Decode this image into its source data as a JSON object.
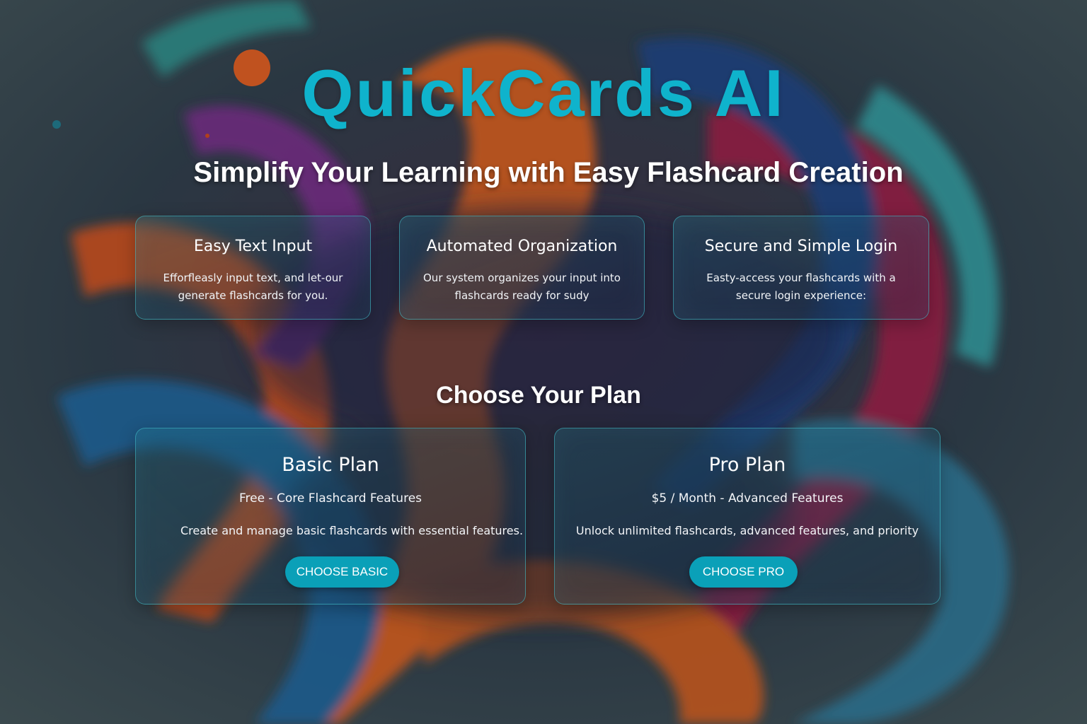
{
  "brand": "QuickCards AI",
  "tagline": "Simplify Your Learning with Easy Flashcard Creation",
  "features": [
    {
      "title": "Easy Text Input",
      "description": "Efforfleasly input text, and let-our generate flashcards for you."
    },
    {
      "title": "Automated Organization",
      "description": "Our system organizes your input into flashcards ready for sudy"
    },
    {
      "title": "Secure and Simple Login",
      "description": "Easty-access your flashcards with a secure login experience:"
    }
  ],
  "plans_heading": "Choose Your Plan",
  "plans": [
    {
      "name": "Basic Plan",
      "price": "Free - Core Flashcard Features",
      "description": "Create and manage basic flashcards with essential features.",
      "button": "CHOOSE BASIC"
    },
    {
      "name": "Pro Plan",
      "price": "$5 / Month - Advanced Features",
      "description": "Unlock unlimited flashcards, advanced features, and priority",
      "button": "CHOOSE PRO"
    }
  ],
  "colors": {
    "brand": "#0fb3cc",
    "accent": "#0aa0b8",
    "background": "#2c3a45"
  }
}
